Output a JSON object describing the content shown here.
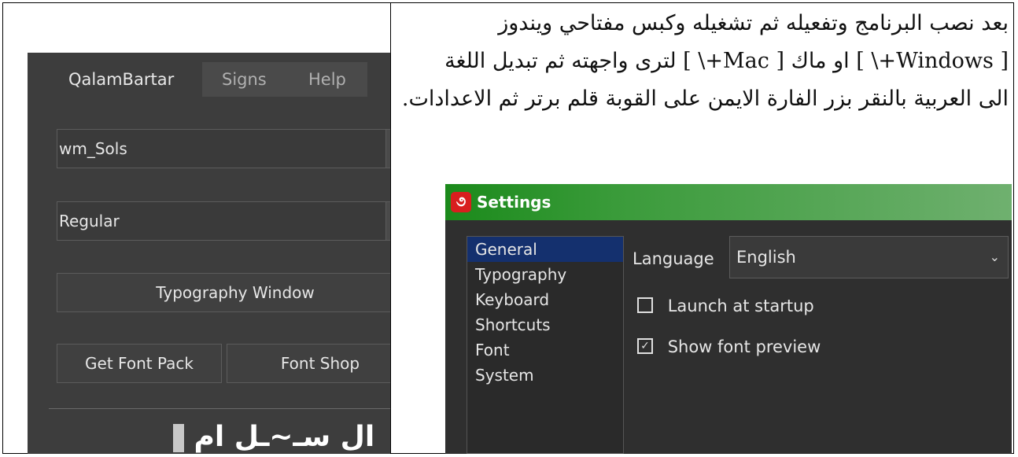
{
  "instructions": {
    "lines": [
      "بعد نصب البرنامج وتفعيله ثم تشغيله وكبس مفتاحي ويندوز",
      "[ Windows+\\ ] او ماك [ Mac+\\ ] لترى واجهته ثم تبديل اللغة",
      "الى العربية بالنقر بزر الفارة الايمن على القوبة قلم برتر ثم الاعدادات."
    ]
  },
  "qalambartar": {
    "tabs": [
      "QalamBartar",
      "Signs",
      "Help"
    ],
    "font_select": "wm_Sols",
    "style_select": "Regular",
    "typography_button": "Typography Window",
    "get_font_pack_button": "Get Font Pack",
    "font_shop_button": "Font Shop",
    "preview_text": "ال سـ~ـل ام"
  },
  "settings": {
    "title": "Settings",
    "nav_items": [
      "General",
      "Typography",
      "Keyboard",
      "Shortcuts",
      "Font",
      "System"
    ],
    "selected_nav": "General",
    "language_label": "Language",
    "language_value": "English",
    "launch_at_startup_label": "Launch at startup",
    "launch_at_startup_checked": false,
    "show_font_preview_label": "Show font preview",
    "show_font_preview_checked": true
  },
  "colors": {
    "panel_bg": "#3d3d3d",
    "titlebar_green": "#1b8a1b",
    "selected_nav": "#14306e",
    "accent_blue_text": "#1f5cd6"
  }
}
